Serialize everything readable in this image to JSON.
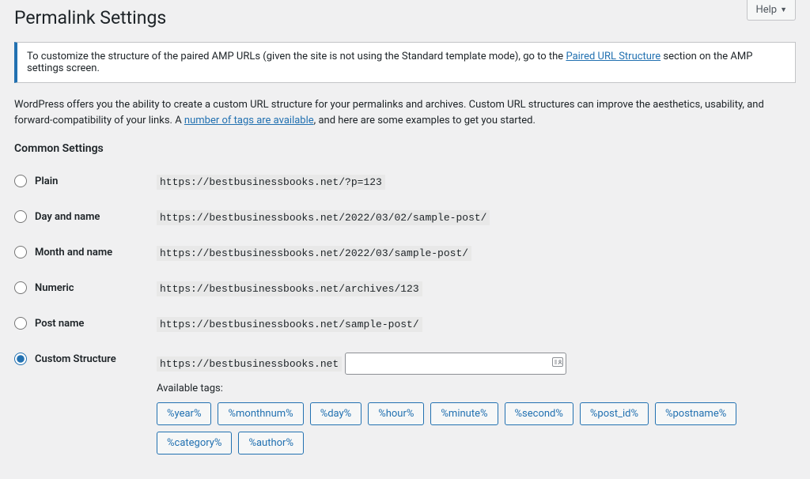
{
  "help": {
    "label": "Help"
  },
  "page_title": "Permalink Settings",
  "notice": {
    "pre": "To customize the structure of the paired AMP URLs (given the site is not using the Standard template mode), go to the ",
    "link": "Paired URL Structure",
    "post": " section on the AMP settings screen."
  },
  "intro": {
    "pre": "WordPress offers you the ability to create a custom URL structure for your permalinks and archives. Custom URL structures can improve the aesthetics, usability, and forward-compatibility of your links. A ",
    "link": "number of tags are available",
    "post": ", and here are some examples to get you started."
  },
  "common_heading": "Common Settings",
  "options": {
    "plain": {
      "label": "Plain",
      "code": "https://bestbusinessbooks.net/?p=123"
    },
    "day": {
      "label": "Day and name",
      "code": "https://bestbusinessbooks.net/2022/03/02/sample-post/"
    },
    "month": {
      "label": "Month and name",
      "code": "https://bestbusinessbooks.net/2022/03/sample-post/"
    },
    "numeric": {
      "label": "Numeric",
      "code": "https://bestbusinessbooks.net/archives/123"
    },
    "postnm": {
      "label": "Post name",
      "code": "https://bestbusinessbooks.net/sample-post/"
    },
    "custom": {
      "label": "Custom Structure",
      "prefix": "https://bestbusinessbooks.net",
      "value": ""
    }
  },
  "available_tags_label": "Available tags:",
  "tags": [
    "%year%",
    "%monthnum%",
    "%day%",
    "%hour%",
    "%minute%",
    "%second%",
    "%post_id%",
    "%postname%",
    "%category%",
    "%author%"
  ]
}
